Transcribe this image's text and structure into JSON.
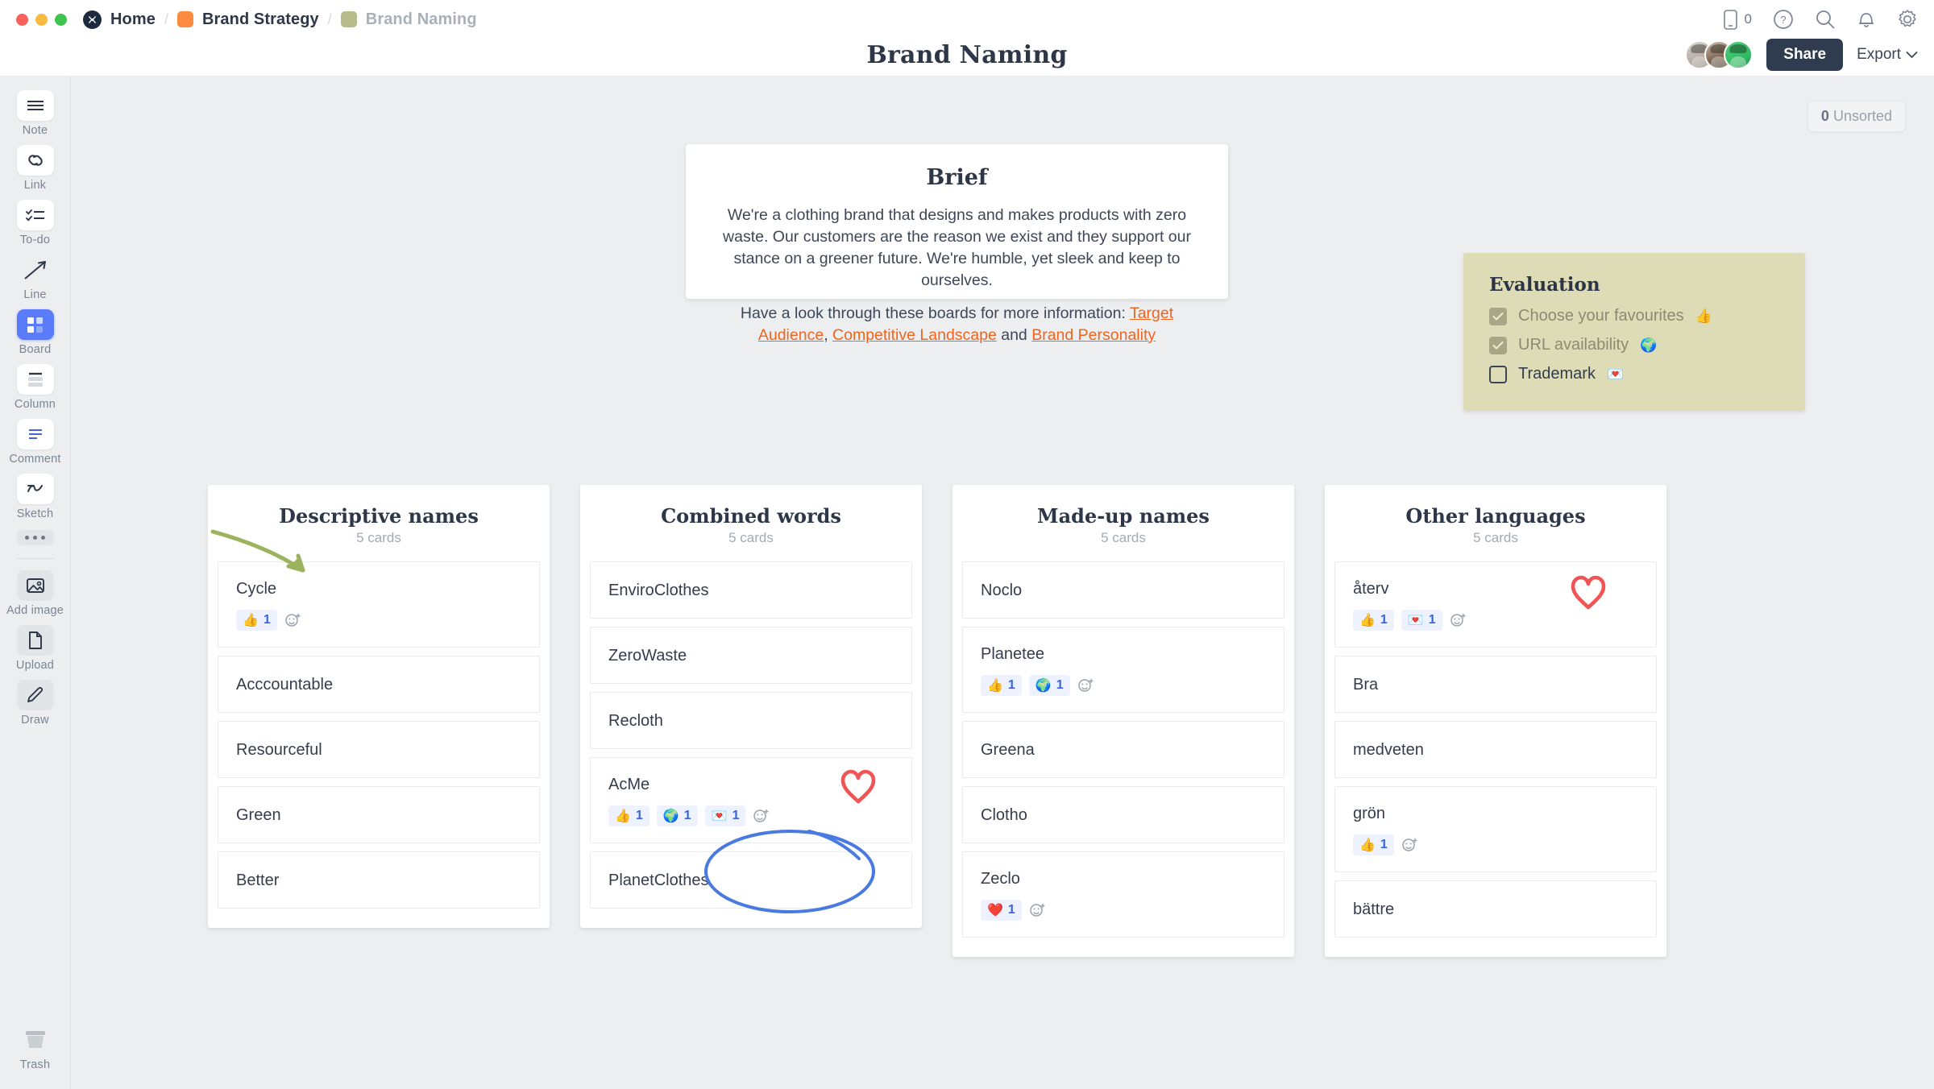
{
  "window": {
    "traffic_lights": [
      "close",
      "minimize",
      "maximize"
    ]
  },
  "breadcrumb": {
    "home": "Home",
    "project": "Brand Strategy",
    "board": "Brand Naming",
    "separator": "/"
  },
  "header": {
    "title": "Brand Naming",
    "share_label": "Share",
    "export_label": "Export",
    "export_caret": "⌄",
    "phone_count": "0",
    "icons": [
      "phone-icon",
      "help-icon",
      "search-icon",
      "bell-icon",
      "gear-icon"
    ]
  },
  "toolbar": {
    "items": [
      {
        "label": "Note",
        "icon": "note-icon",
        "active": false
      },
      {
        "label": "Link",
        "icon": "link-icon",
        "active": false
      },
      {
        "label": "To-do",
        "icon": "todo-icon",
        "active": false
      },
      {
        "label": "Line",
        "icon": "line-icon",
        "active": false
      },
      {
        "label": "Board",
        "icon": "board-icon",
        "active": true
      },
      {
        "label": "Column",
        "icon": "column-icon",
        "active": false
      },
      {
        "label": "Comment",
        "icon": "comment-icon",
        "active": false
      },
      {
        "label": "Sketch",
        "icon": "sketch-icon",
        "active": false
      }
    ],
    "more_label": "more-options",
    "secondary": [
      {
        "label": "Add image",
        "icon": "image-icon"
      },
      {
        "label": "Upload",
        "icon": "upload-icon"
      },
      {
        "label": "Draw",
        "icon": "pencil-icon"
      }
    ],
    "trash_label": "Trash"
  },
  "canvas": {
    "unsorted_count": "0",
    "unsorted_label": "Unsorted"
  },
  "brief": {
    "heading": "Brief",
    "paragraph1": "We're a clothing brand that designs and makes products with zero waste. Our customers are the reason we exist and they support our stance on a greener future. We're humble, yet sleek and keep to ourselves.",
    "paragraph2_prefix": "Have a look through these boards for more information: ",
    "link1": "Target Audience",
    "comma": ", ",
    "link2": "Competitive Landscape",
    "conjunction": " and ",
    "link3": "Brand Personality"
  },
  "evaluation": {
    "heading": "Evaluation",
    "items": [
      {
        "label": "Choose your favourites",
        "emoji": "👍",
        "checked": true
      },
      {
        "label": "URL availability",
        "emoji": "🌍",
        "checked": true
      },
      {
        "label": "Trademark",
        "emoji": "💌",
        "checked": false
      }
    ]
  },
  "columns": [
    {
      "title": "Descriptive names",
      "count_label": "5 cards",
      "cards": [
        {
          "title": "Cycle",
          "reactions": [
            {
              "emoji": "👍",
              "count": "1"
            }
          ]
        },
        {
          "title": "Acccountable",
          "reactions": []
        },
        {
          "title": "Resourceful",
          "reactions": []
        },
        {
          "title": "Green",
          "reactions": []
        },
        {
          "title": "Better",
          "reactions": []
        }
      ]
    },
    {
      "title": "Combined words",
      "count_label": "5 cards",
      "cards": [
        {
          "title": "EnviroClothes",
          "reactions": []
        },
        {
          "title": "ZeroWaste",
          "reactions": []
        },
        {
          "title": "Recloth",
          "reactions": []
        },
        {
          "title": "AcMe",
          "reactions": [
            {
              "emoji": "👍",
              "count": "1"
            },
            {
              "emoji": "🌍",
              "count": "1"
            },
            {
              "emoji": "💌",
              "count": "1"
            }
          ]
        },
        {
          "title": "PlanetClothes",
          "reactions": []
        }
      ]
    },
    {
      "title": "Made-up names",
      "count_label": "5 cards",
      "cards": [
        {
          "title": "Noclo",
          "reactions": []
        },
        {
          "title": "Planetee",
          "reactions": [
            {
              "emoji": "👍",
              "count": "1"
            },
            {
              "emoji": "🌍",
              "count": "1"
            }
          ]
        },
        {
          "title": "Greena",
          "reactions": []
        },
        {
          "title": "Clotho",
          "reactions": []
        },
        {
          "title": "Zeclo",
          "reactions": [
            {
              "emoji": "❤️",
              "count": "1"
            }
          ]
        }
      ]
    },
    {
      "title": "Other languages",
      "count_label": "5 cards",
      "cards": [
        {
          "title": "återv",
          "reactions": [
            {
              "emoji": "👍",
              "count": "1"
            },
            {
              "emoji": "💌",
              "count": "1"
            }
          ]
        },
        {
          "title": "Bra",
          "reactions": []
        },
        {
          "title": "medveten",
          "reactions": []
        },
        {
          "title": "grön",
          "reactions": [
            {
              "emoji": "👍",
              "count": "1"
            }
          ]
        },
        {
          "title": "bättre",
          "reactions": []
        }
      ]
    }
  ],
  "annotations": {
    "arrow_color": "#9cb35e",
    "ellipse_color": "#4a7ae0",
    "heart_color": "#f05454",
    "arrow_target": "Cycle card",
    "ellipse_target": "AcMe reactions",
    "hearts": [
      "AcMe card",
      "återv card"
    ]
  },
  "colors": {
    "canvas_bg": "#eceef0",
    "accent_blue": "#5b7cfa",
    "brand_navy": "#2f3b4e",
    "link_orange": "#f0641e",
    "evaluation_bg": "#dedcb6"
  }
}
